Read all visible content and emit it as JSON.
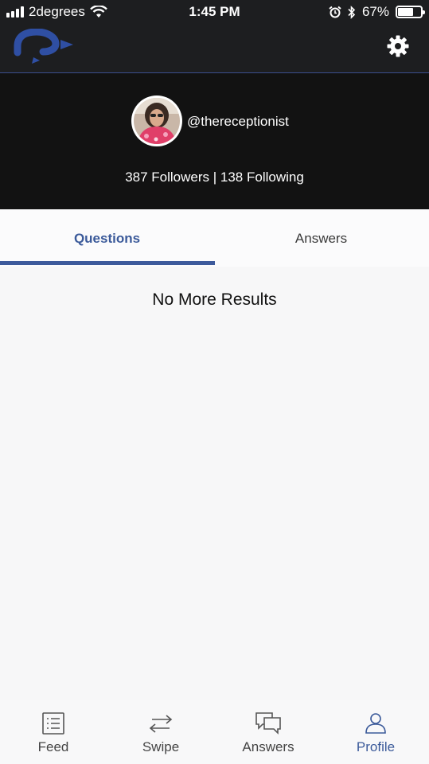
{
  "status_bar": {
    "carrier": "2degrees",
    "time": "1:45 PM",
    "battery_percent": "67%",
    "battery_level": 0.67,
    "icons": [
      "signal-icon",
      "wifi-icon",
      "alarm-icon",
      "bluetooth-icon",
      "battery-icon"
    ]
  },
  "header": {
    "logo": "question-mark-logo",
    "settings_icon": "gear-icon",
    "accent_color": "#2f4fa3"
  },
  "profile": {
    "username": "@thereceptionist",
    "stats": "387 Followers | 138 Following"
  },
  "tabs": [
    {
      "label": "Questions",
      "active": true
    },
    {
      "label": "Answers",
      "active": false
    }
  ],
  "content": {
    "empty_message": "No More Results"
  },
  "bottom_nav": [
    {
      "label": "Feed",
      "icon": "feed-icon",
      "active": false
    },
    {
      "label": "Swipe",
      "icon": "swipe-icon",
      "active": false
    },
    {
      "label": "Answers",
      "icon": "answers-icon",
      "active": false
    },
    {
      "label": "Profile",
      "icon": "profile-icon",
      "active": true
    }
  ],
  "colors": {
    "active": "#3b5a9a",
    "header_bg": "#1d1e20",
    "profile_bg": "#121212"
  }
}
